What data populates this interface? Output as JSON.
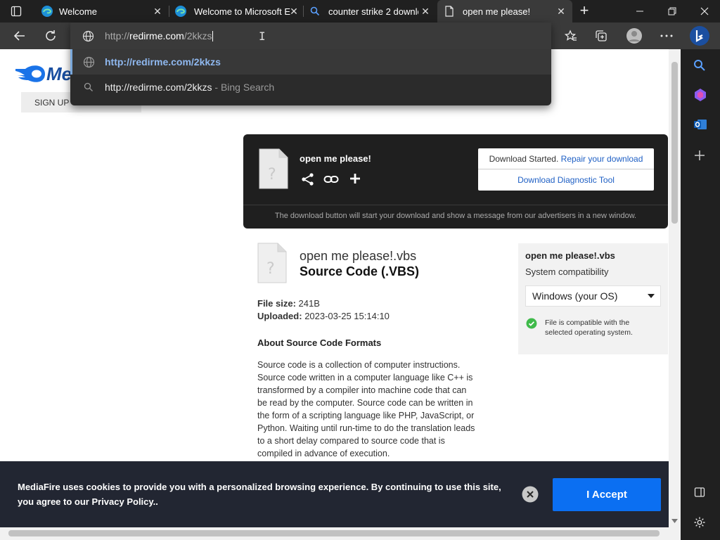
{
  "tabs": [
    {
      "title": "Welcome",
      "icon": "edge-icon"
    },
    {
      "title": "Welcome to Microsoft E",
      "icon": "edge-icon"
    },
    {
      "title": "counter strike 2 downlo",
      "icon": "search-icon"
    },
    {
      "title": "open me please!",
      "icon": "document-icon",
      "active": true
    }
  ],
  "omnibox": {
    "url_prefix": "http://",
    "url_host": "redirme.com",
    "url_path": "/2kkzs",
    "suggestions": [
      {
        "text": "http://redirme.com/2kkzs",
        "suffix": "",
        "icon": "globe-icon",
        "selected": true
      },
      {
        "text": "http://redirme.com/2kkzs",
        "suffix": " - Bing Search",
        "icon": "search-icon"
      }
    ]
  },
  "page": {
    "logo_text": "Me",
    "signup_label": "SIGN UP",
    "card": {
      "file_title": "open me please!",
      "download_started": "Download Started.",
      "repair_link": "Repair your download",
      "diagnostic_link": "Download Diagnostic Tool",
      "note": "The download button will start your download and show a message from our advertisers in a new window."
    },
    "file": {
      "name": "open me please!.vbs",
      "type": "Source Code (.VBS)",
      "size_label": "File size:",
      "size_value": "241B",
      "uploaded_label": "Uploaded:",
      "uploaded_value": "2023-03-25 15:14:10",
      "about_heading": "About Source Code Formats",
      "about_lines": [
        "Source code is a collection of computer instructions.",
        "Source code written in a computer language like C++ is",
        "transformed by a compiler into machine code that can",
        "be read by the computer. Source code can be written in",
        "the form of a scripting language like PHP, JavaScript, or",
        "Python. Waiting until run-time to do the translation leads",
        "to a short delay compared to source code that is",
        "compiled in advance of execution."
      ]
    },
    "compat": {
      "file_name": "open me please!.vbs",
      "heading": "System compatibility",
      "os_selected": "Windows (your OS)",
      "status_line1": "File is compatible with the",
      "status_line2": "selected operating system."
    },
    "cookie": {
      "line1": "MediaFire uses cookies to provide you with a personalized browsing experience. By continuing to use this site,",
      "line2": "you agree to our Privacy Policy..",
      "accept_label": "I Accept"
    }
  },
  "colors": {
    "accent": "#1a73e8",
    "link": "#1e5fc4",
    "dark_card": "#1f1f1f",
    "cookie_bg": "#222632",
    "accept_btn": "#0b6ff2",
    "compat_ok": "#3fba4a"
  }
}
